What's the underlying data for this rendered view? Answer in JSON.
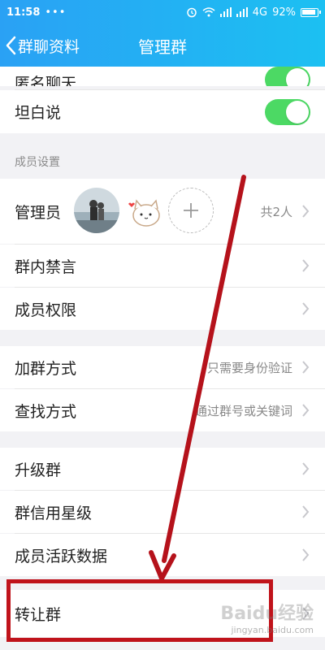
{
  "status": {
    "time": "11:58",
    "dots": "•••",
    "network": "4G",
    "battery": "92%",
    "battery_level": 0.92
  },
  "nav": {
    "back_label": "群聊资料",
    "title": "管理群"
  },
  "rows": {
    "anonymous_chat": "匿名聊天",
    "frank_talk": "坦白说",
    "member_settings_header": "成员设置",
    "admins": {
      "label": "管理员",
      "count": "共2人"
    },
    "group_mute": "群内禁言",
    "member_permissions": "成员权限",
    "join_method": {
      "label": "加群方式",
      "value": "只需要身份验证"
    },
    "search_method": {
      "label": "查找方式",
      "value": "通过群号或关键词"
    },
    "upgrade_group": "升级群",
    "group_credit": "群信用星级",
    "member_activity": "成员活跃数据",
    "transfer_group": "转让群"
  },
  "watermark": {
    "brand": "Baidu经验",
    "url": "jingyan.baidu.com"
  },
  "colors": {
    "header_start": "#2aa1f4",
    "header_end": "#1cc0f2",
    "toggle_on": "#4cd964",
    "annotation_red": "#c0131b"
  }
}
